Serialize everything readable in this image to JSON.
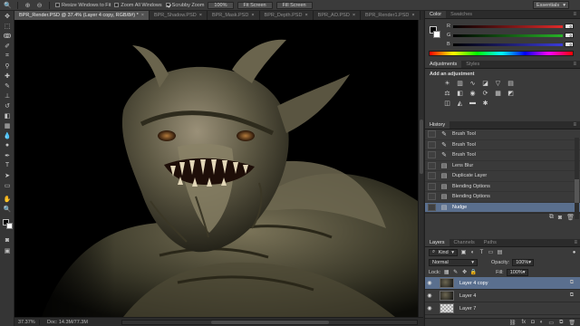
{
  "options_bar": {
    "resize_windows_label": "Resize Windows to Fit",
    "zoom_all_label": "Zoom All Windows",
    "scrubby_zoom_label": "Scrubby Zoom",
    "actual_pixels_label": "100%",
    "fit_screen_label": "Fit Screen",
    "fill_screen_label": "Fill Screen",
    "workspace_label": "Essentials"
  },
  "tabs": [
    {
      "label": "BPR_Render.PSD @ 37.4% (Layer 4 copy, RGB/8#) *",
      "active": true
    },
    {
      "label": "BPR_Shadow.PSD",
      "active": false
    },
    {
      "label": "BPR_Mask.PSD",
      "active": false
    },
    {
      "label": "BPR_Depth.PSD",
      "active": false
    },
    {
      "label": "BPR_AO.PSD",
      "active": false
    },
    {
      "label": "BPR_Render1.PSD",
      "active": false
    }
  ],
  "tab_close_glyph": "×",
  "status": {
    "zoom": "37.37%",
    "doc": "Doc: 14.3M/77.3M"
  },
  "color_panel": {
    "tabs": [
      "Color",
      "Swatches"
    ],
    "channels": [
      {
        "label": "R",
        "value": "0",
        "color": "#e02a2a"
      },
      {
        "label": "G",
        "value": "0",
        "color": "#27b227"
      },
      {
        "label": "B",
        "value": "0",
        "color": "#3b3bd9"
      }
    ]
  },
  "adjustments_panel": {
    "tabs": [
      "Adjustments",
      "Styles"
    ],
    "title": "Add an adjustment",
    "icons": [
      {
        "name": "brightness-contrast-icon",
        "glyph": "☀"
      },
      {
        "name": "levels-icon",
        "glyph": "▥"
      },
      {
        "name": "curves-icon",
        "glyph": "∿"
      },
      {
        "name": "exposure-icon",
        "glyph": "◪"
      },
      {
        "name": "vibrance-icon",
        "glyph": "▽"
      },
      {
        "name": "hue-saturation-icon",
        "glyph": "▤"
      },
      {
        "name": "color-balance-icon",
        "glyph": "⚖"
      },
      {
        "name": "black-white-icon",
        "glyph": "◧"
      },
      {
        "name": "photo-filter-icon",
        "glyph": "◉"
      },
      {
        "name": "channel-mixer-icon",
        "glyph": "⟳"
      },
      {
        "name": "color-lookup-icon",
        "glyph": "▦"
      },
      {
        "name": "invert-icon",
        "glyph": "◩"
      },
      {
        "name": "posterize-icon",
        "glyph": "◫"
      },
      {
        "name": "threshold-icon",
        "glyph": "◭"
      },
      {
        "name": "gradient-map-icon",
        "glyph": "▬"
      },
      {
        "name": "selective-color-icon",
        "glyph": "✱"
      }
    ]
  },
  "history_panel": {
    "tabs": [
      "History"
    ],
    "items": [
      {
        "label": "Brush Tool",
        "icon": "brush-icon",
        "glyph": "✎",
        "selected": false
      },
      {
        "label": "Brush Tool",
        "icon": "brush-icon",
        "glyph": "✎",
        "selected": false
      },
      {
        "label": "Brush Tool",
        "icon": "brush-icon",
        "glyph": "✎",
        "selected": false
      },
      {
        "label": "Lens Blur",
        "icon": "filter-icon",
        "glyph": "▤",
        "selected": false
      },
      {
        "label": "Duplicate Layer",
        "icon": "layer-icon",
        "glyph": "▤",
        "selected": false
      },
      {
        "label": "Blending Options",
        "icon": "layer-icon",
        "glyph": "▤",
        "selected": false
      },
      {
        "label": "Blending Options",
        "icon": "layer-icon",
        "glyph": "▤",
        "selected": false
      },
      {
        "label": "Nudge",
        "icon": "move-icon",
        "glyph": "▤",
        "selected": true
      }
    ]
  },
  "layers_panel": {
    "tabs": [
      "Layers",
      "Channels",
      "Paths"
    ],
    "kind_label": "Kind",
    "blend_mode": "Normal",
    "opacity_label": "Opacity:",
    "opacity_value": "100%",
    "lock_label": "Lock:",
    "fill_label": "Fill:",
    "fill_value": "100%",
    "layers": [
      {
        "name": "Layer 4 copy",
        "visible": true,
        "selected": true,
        "thumb": "dark",
        "fx": "⧉"
      },
      {
        "name": "Layer 4",
        "visible": true,
        "selected": false,
        "thumb": "dark",
        "fx": "⧉"
      },
      {
        "name": "Layer 7",
        "visible": true,
        "selected": false,
        "thumb": "checker",
        "fx": ""
      }
    ]
  }
}
